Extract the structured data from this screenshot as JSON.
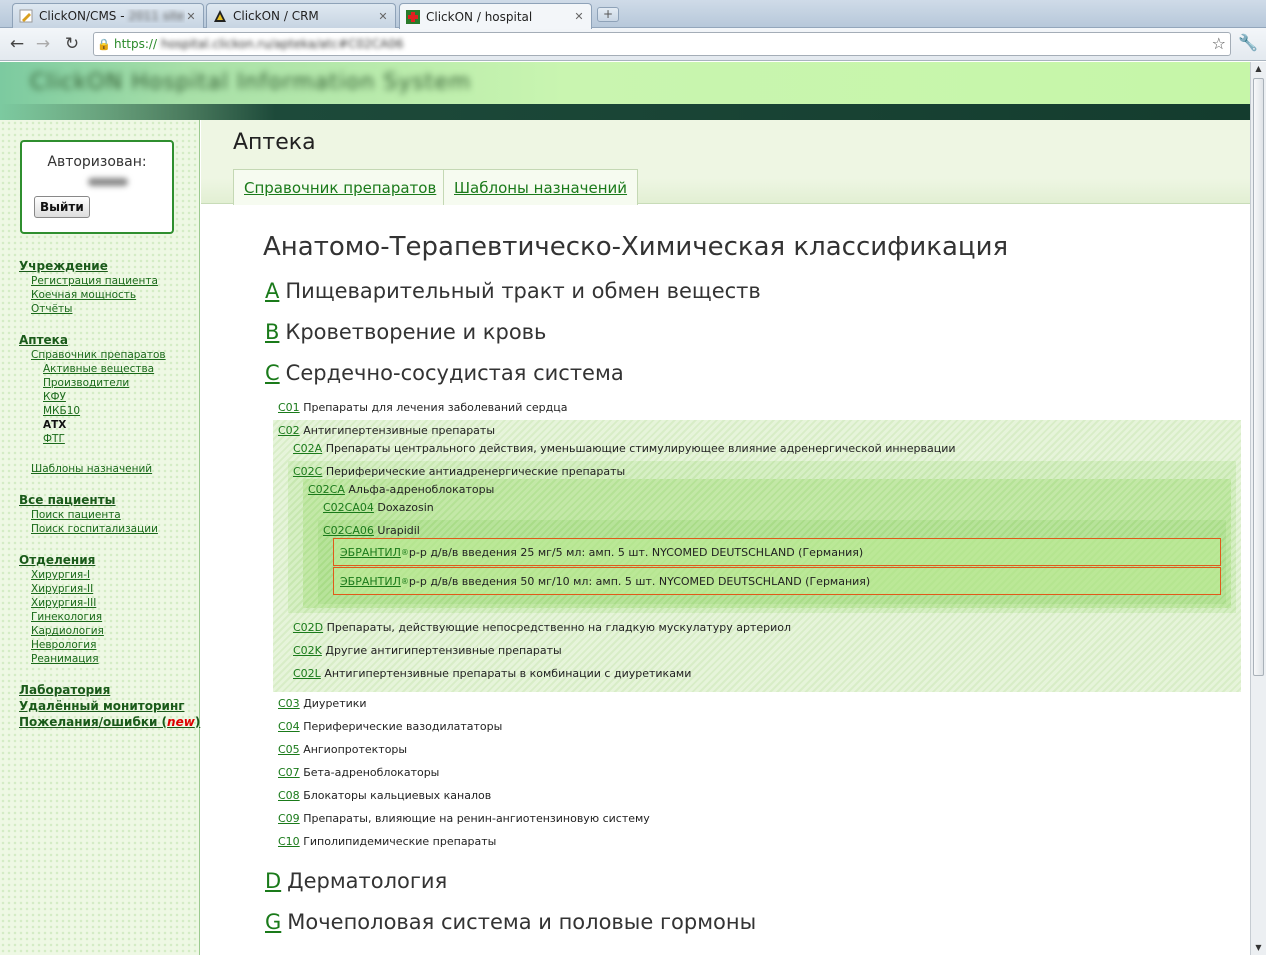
{
  "browser": {
    "tabs": [
      {
        "title": "ClickON/CMS - ",
        "title_blurred": "2011 site"
      },
      {
        "title": "ClickON / CRM",
        "title_blurred": ""
      },
      {
        "title": "ClickON / hospital",
        "title_blurred": ""
      }
    ],
    "new_tab_label": "+",
    "address": {
      "scheme": "https://",
      "rest": "hospital.clickon.ru/apteka/atc#C02CA06"
    }
  },
  "site": {
    "logo_text": "ClickON Hospital Information System"
  },
  "auth": {
    "label": "Авторизован:",
    "logout_label": "Выйти"
  },
  "sidebar": {
    "institution": "Учреждение",
    "institution_items": [
      "Регистрация пациента",
      "Коечная мощность",
      "Отчёты"
    ],
    "pharmacy": "Аптека",
    "directory": "Справочник препаратов",
    "directory_items": [
      "Активные вещества",
      "Производители",
      "КФУ",
      "МКБ10",
      "АТХ",
      "ФТГ"
    ],
    "templates": "Шаблоны назначений",
    "patients": "Все пациенты",
    "patients_items": [
      "Поиск пациента",
      "Поиск госпитализации"
    ],
    "departments": "Отделения",
    "departments_items": [
      "Хирургия-I",
      "Хирургия-II",
      "Хирургия-III",
      "Гинекология",
      "Кардиология",
      "Неврология",
      "Реанимация"
    ],
    "lab": "Лаборатория",
    "monitoring": "Удалённый мониторинг",
    "feedback": "Пожелания/ошибки (",
    "feedback_new": "new",
    "feedback_end": ")"
  },
  "content": {
    "page_title": "Аптека",
    "tabs": [
      "Справочник препаратов",
      "Шаблоны назначений"
    ],
    "heading": "Анатомо-Терапевтическо-Химическая классификация",
    "groups": {
      "A": {
        "code": "A",
        "name": "Пищеварительный тракт и обмен веществ"
      },
      "B": {
        "code": "B",
        "name": "Кроветворение и кровь"
      },
      "C": {
        "code": "C",
        "name": "Сердечно-сосудистая система"
      },
      "D": {
        "code": "D",
        "name": "Дерматология"
      },
      "G": {
        "code": "G",
        "name": "Мочеполовая система и половые гормоны"
      }
    },
    "c01": {
      "code": "C01",
      "name": "Препараты для лечения заболеваний сердца"
    },
    "c02": {
      "code": "C02",
      "name": "Антигипертензивные препараты"
    },
    "c02a": {
      "code": "C02A",
      "name": "Препараты центрального действия, уменьшающие стимулирующее влияние адренергической иннервации"
    },
    "c02c": {
      "code": "C02C",
      "name": "Периферические антиадренергические препараты"
    },
    "c02ca": {
      "code": "C02CA",
      "name": "Альфа-адреноблокаторы"
    },
    "c02ca04": {
      "code": "C02CA04",
      "name": "Doxazosin"
    },
    "c02ca06": {
      "code": "C02CA06",
      "name": "Urapidil"
    },
    "drugs": [
      {
        "name": "ЭБРАНТИЛ",
        "reg": "®",
        "desc": " р-р д/в/в введения 25 мг/5 мл: амп. 5 шт.   NYCOMED DEUTSCHLAND (Германия)"
      },
      {
        "name": "ЭБРАНТИЛ",
        "reg": "®",
        "desc": " р-р д/в/в введения 50 мг/10 мл: амп. 5 шт.   NYCOMED DEUTSCHLAND (Германия)"
      }
    ],
    "c02d": {
      "code": "C02D",
      "name": "Препараты, действующие непосредственно на гладкую мускулатуру артериол"
    },
    "c02k": {
      "code": "C02K",
      "name": "Другие антигипертензивные препараты"
    },
    "c02l": {
      "code": "C02L",
      "name": "Антигипертензивные препараты в комбинации с диуретиками"
    },
    "c_rest": [
      {
        "code": "C03",
        "name": "Диуретики"
      },
      {
        "code": "C04",
        "name": "Периферические вазодилататоры"
      },
      {
        "code": "C05",
        "name": "Ангиопротекторы"
      },
      {
        "code": "C07",
        "name": "Бета-адреноблокаторы"
      },
      {
        "code": "C08",
        "name": "Блокаторы кальциевых каналов"
      },
      {
        "code": "C09",
        "name": "Препараты, влияющие на ренин-ангиотензиновую систему"
      },
      {
        "code": "C10",
        "name": "Гиполипидемические препараты"
      }
    ]
  }
}
